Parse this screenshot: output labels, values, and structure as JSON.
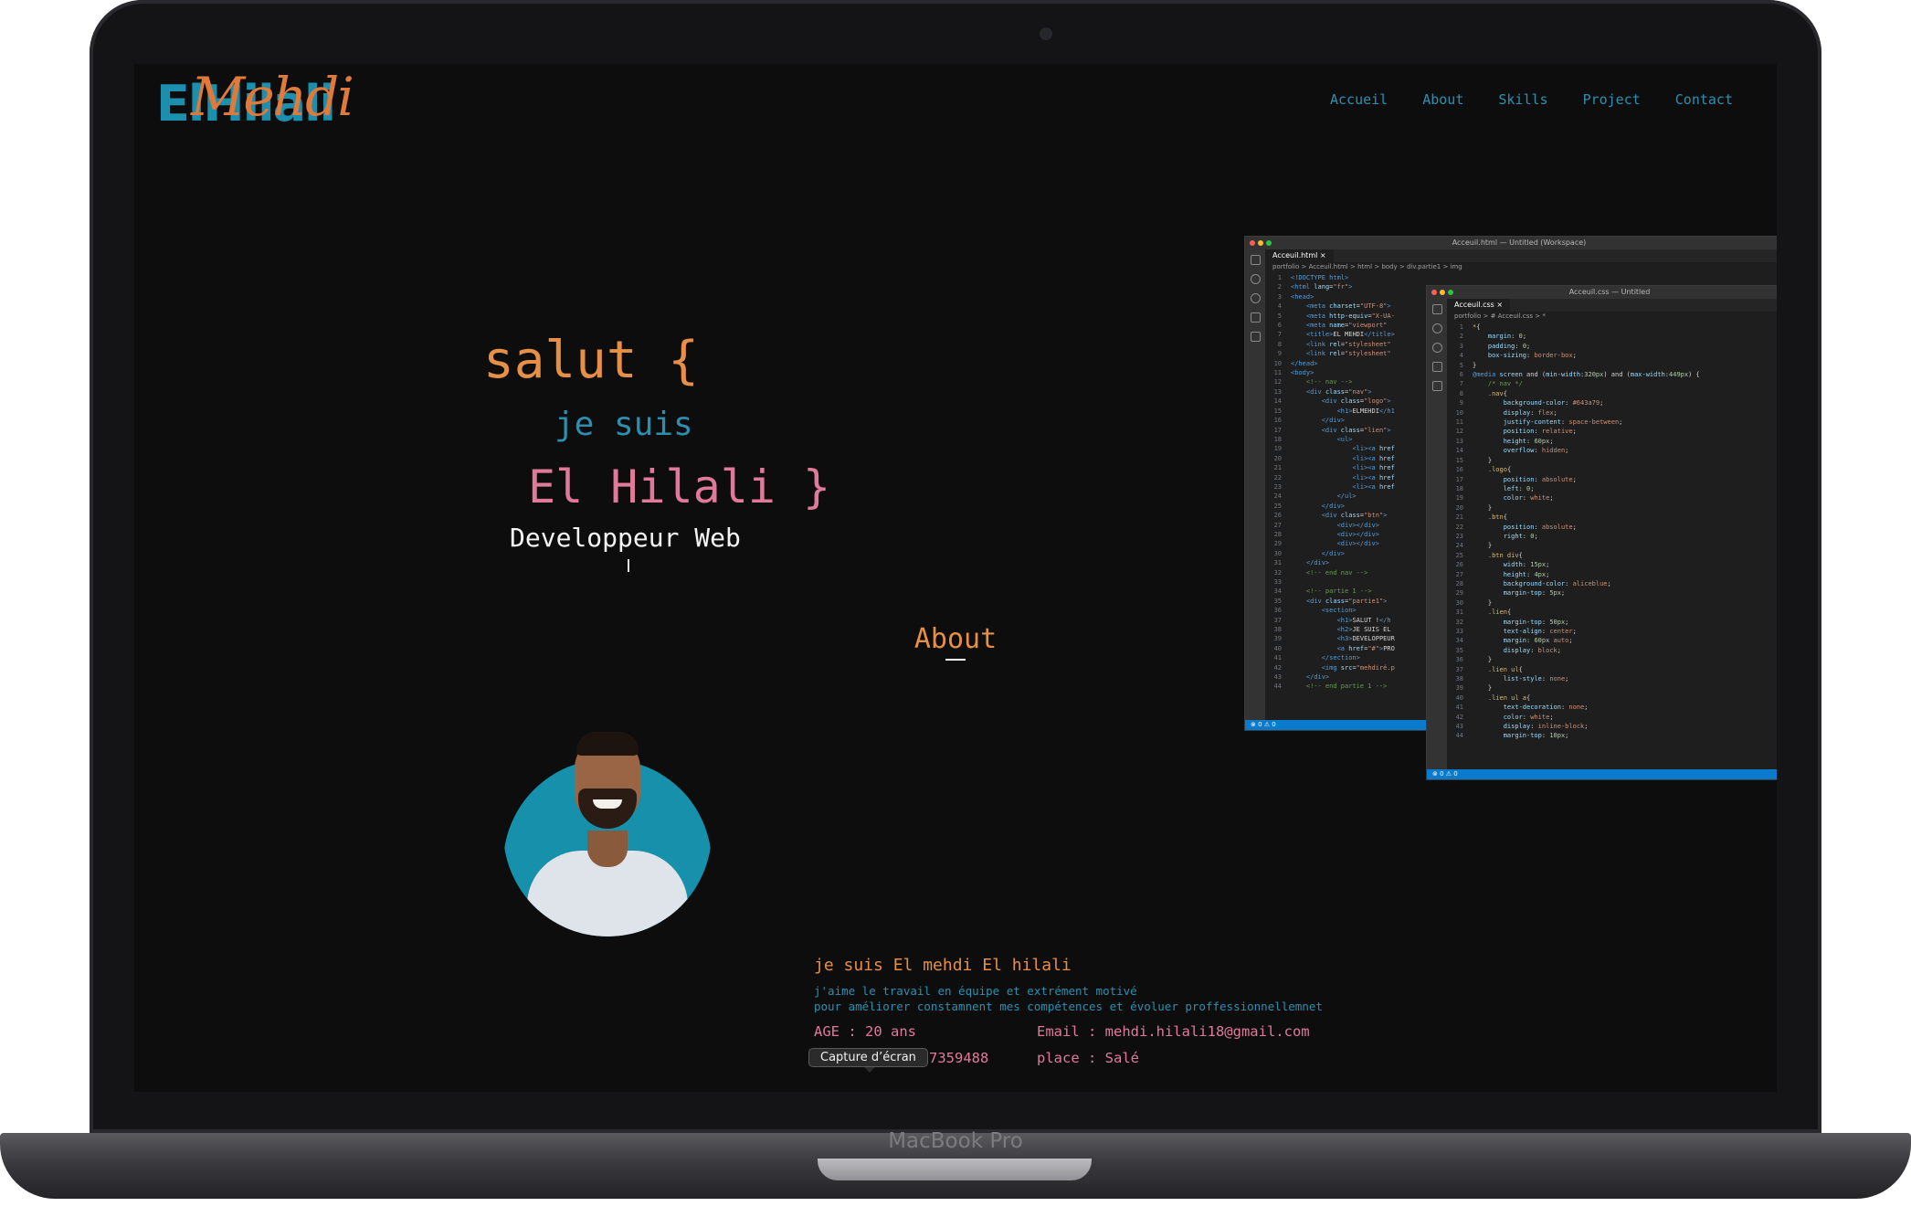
{
  "device": {
    "model_label": "MacBook Pro"
  },
  "site": {
    "logo": {
      "main": "ElHilali",
      "script": "Mehdi"
    },
    "nav": [
      "Accueil",
      "About",
      "Skills",
      "Project",
      "Contact"
    ]
  },
  "hero": {
    "greeting": "salut {",
    "intro": "je suis",
    "name": "El Hilali }",
    "role": "Developpeur Web"
  },
  "editor_html": {
    "title": "Acceuil.html — Untitled (Workspace)",
    "tab": "Acceuil.html",
    "breadcrumb": "portfolio > Acceuil.html > html > body > div.partie1 > img",
    "status": "⊗ 0 ⚠ 0"
  },
  "editor_css": {
    "title": "Acceuil.css — Untitled",
    "tab": "Acceuil.css",
    "breadcrumb": "portfolio > # Acceuil.css > *",
    "status": "⊗ 0 ⚠ 0"
  },
  "about": {
    "title": "About",
    "heading": "je suis El mehdi El hilali",
    "line1": "j'aime le travail en équipe et extrément motivé",
    "line2": "pour améliorer constamnent mes compétences et évoluer proffessionnellemnet",
    "age": "AGE : 20 ans",
    "email": "Email : mehdi.hilali18@gmail.com",
    "phone_partial": "7359488",
    "place": "place : Salé"
  },
  "tooltip": "Capture d’écran",
  "colors": {
    "accent_orange": "#e58f47",
    "accent_blue": "#2c8fb0",
    "accent_pink": "#e07a9a",
    "background": "#0d0d0d"
  }
}
